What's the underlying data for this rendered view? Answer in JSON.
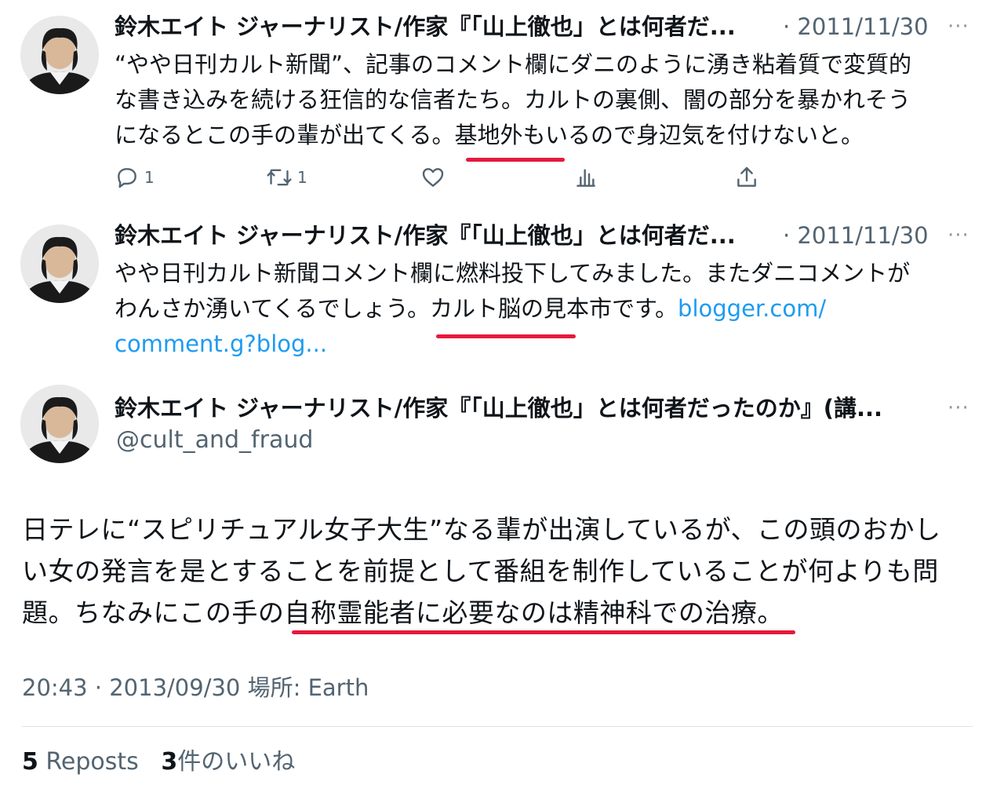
{
  "tweets": [
    {
      "name": "鈴木エイト ジャーナリスト/作家『「山上徹也」とは何者だ...",
      "date": "· 2011/11/30",
      "more": "···",
      "lines": [
        "“やや日刊カルト新聞”、記事のコメント欄にダニのように湧き粘着質で変質的",
        "な書き込みを続ける狂信的な信者たち。カルトの裏側、闇の部分を暴かれそう",
        "になるとこの手の輩が出てくる。基地外もいるので身辺気を付けないと。"
      ],
      "actions": {
        "reply_count": "1",
        "repost_count": "1"
      }
    },
    {
      "name": "鈴木エイト ジャーナリスト/作家『「山上徹也」とは何者だ...",
      "date": "· 2011/11/30",
      "more": "···",
      "lines": [
        "やや日刊カルト新聞コメント欄に燃料投下してみました。またダニコメントが",
        "わんさか湧いてくるでしょう。カルト脳の見本市です。"
      ],
      "link_part1": "blogger.com/",
      "link_part2": "comment.g?blog..."
    }
  ],
  "main_tweet": {
    "name": "鈴木エイト ジャーナリスト/作家『「山上徹也」とは何者だったのか』(講...",
    "handle": "@cult_and_fraud",
    "more": "···",
    "lines": [
      "日テレに“スピリチュアル女子大生”なる輩が出演しているが、この頭のおかし",
      "い女の発言を是とすることを前提として番組を制作していることが何よりも問",
      "題。ちなみにこの手の自称霊能者に必要なのは精神科での治療。"
    ],
    "meta": "20:43 · 2013/09/30 場所: Earth",
    "reposts_count": "5",
    "reposts_label": "Reposts",
    "likes_count": "3",
    "likes_label": "件のいいね"
  },
  "colors": {
    "underline": "#e5193d",
    "link": "#1d9bf0",
    "secondary": "#536471"
  },
  "icons": [
    "reply-icon",
    "repost-icon",
    "like-icon",
    "views-icon",
    "share-icon",
    "more-icon"
  ]
}
